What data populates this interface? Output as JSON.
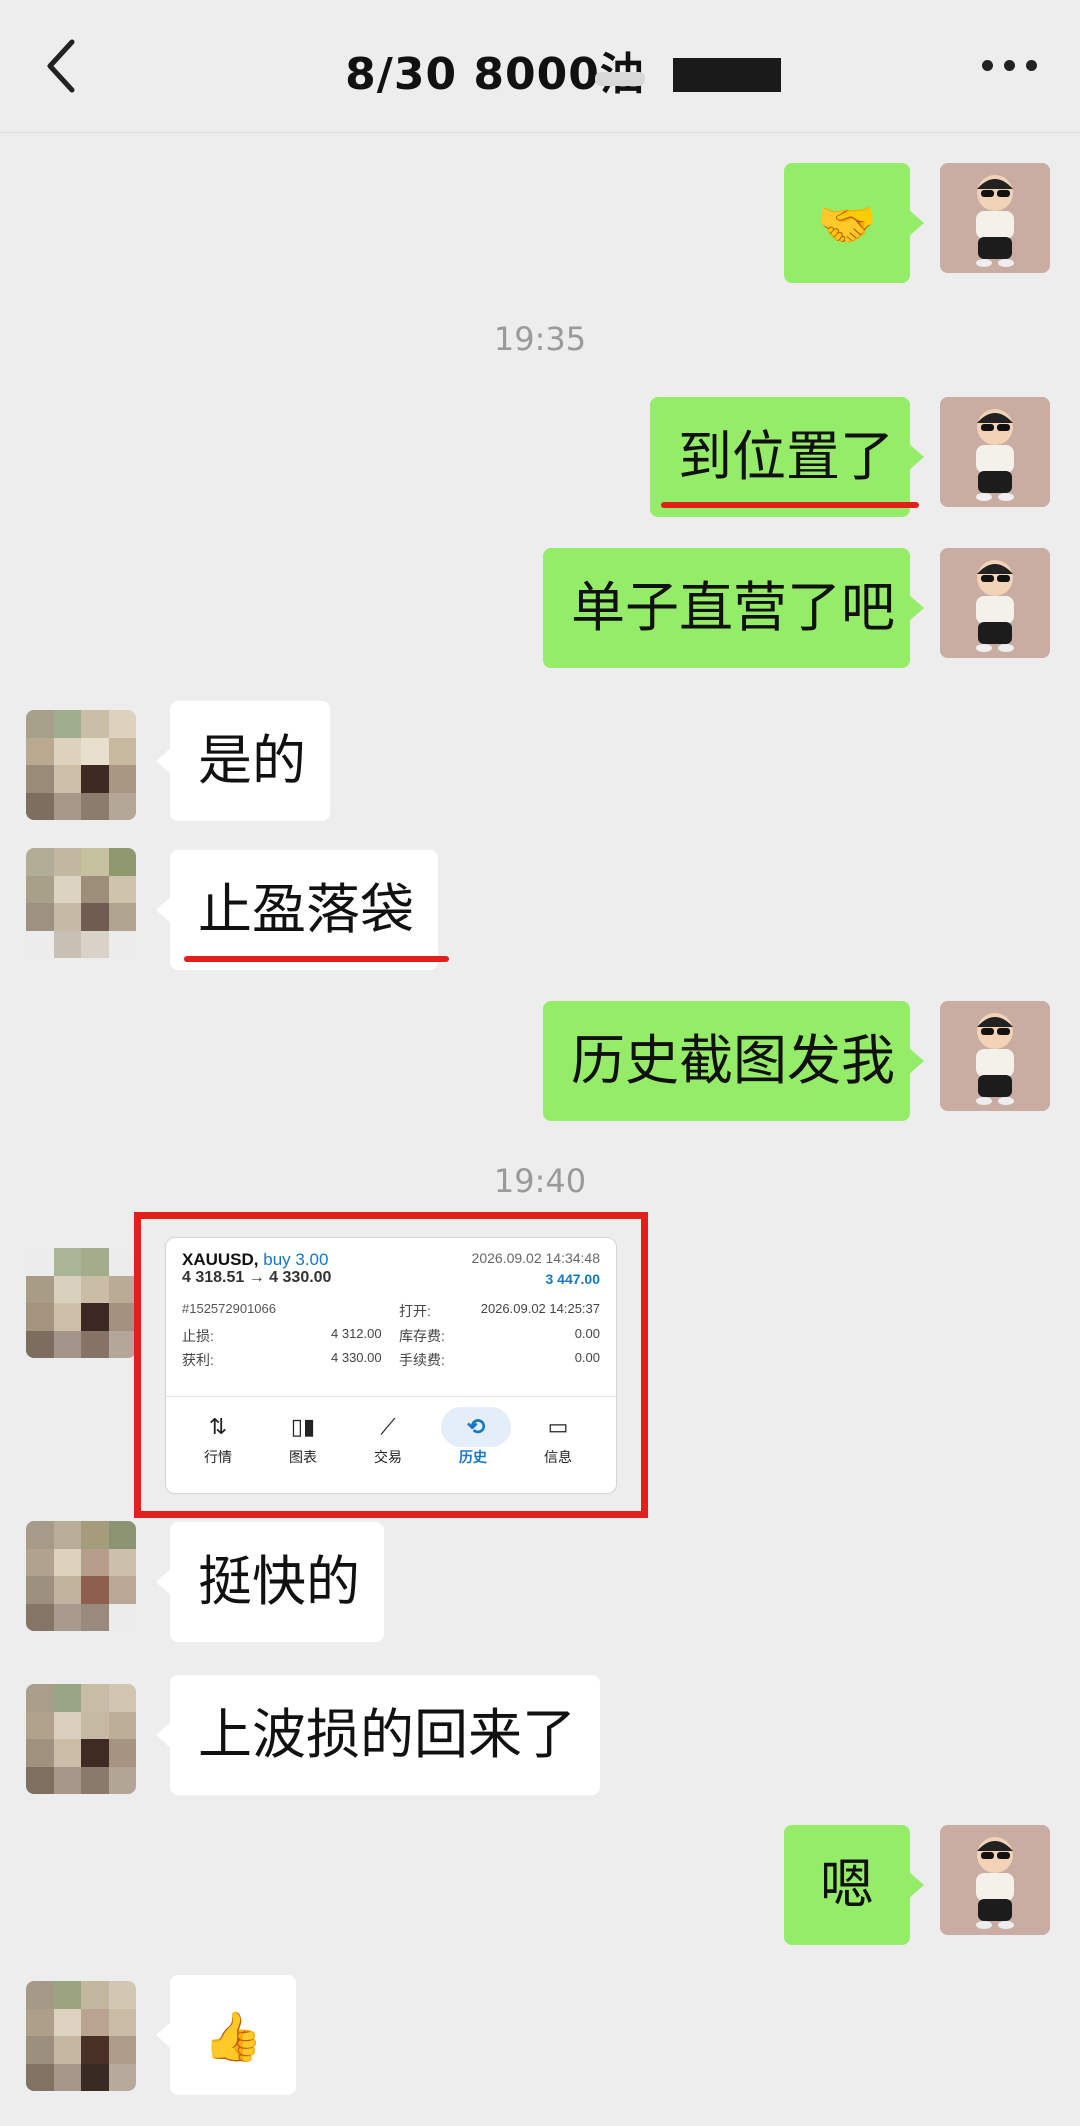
{
  "header": {
    "title": "8/30  8000油",
    "back_icon": "chevron-left-icon",
    "more_icon": "more-dots-icon"
  },
  "messages": {
    "m1": "🤝",
    "t1": "19:35",
    "m2": "到位置了",
    "m3": "单子直营了吧",
    "m4": "是的",
    "m5": "止盈落袋",
    "m6": "历史截图发我",
    "t2": "19:40",
    "m7": "挺快的",
    "m8": "上波损的回来了",
    "m9": "嗯",
    "m10": "👍"
  },
  "trade_card": {
    "symbol": "XAUUSD,",
    "side": "buy 3.00",
    "prices": "4 318.51 → 4 330.00",
    "close_time": "2026.09.02 14:34:48",
    "profit": "3 447.00",
    "ticket": "#152572901066",
    "open_label": "打开:",
    "open_time": "2026.09.02 14:25:37",
    "sl_label": "止损:",
    "sl_value": "4 312.00",
    "swap_label": "库存费:",
    "swap_value": "0.00",
    "tp_label": "获利:",
    "tp_value": "4 330.00",
    "fee_label": "手续费:",
    "fee_value": "0.00",
    "tabs": [
      "行情",
      "图表",
      "交易",
      "历史",
      "信息"
    ]
  },
  "colors": {
    "my_bubble": "#95ec69",
    "their_bubble": "#ffffff",
    "highlight_red": "#e0201b",
    "profit_blue": "#1677c8",
    "background": "#ededed"
  }
}
